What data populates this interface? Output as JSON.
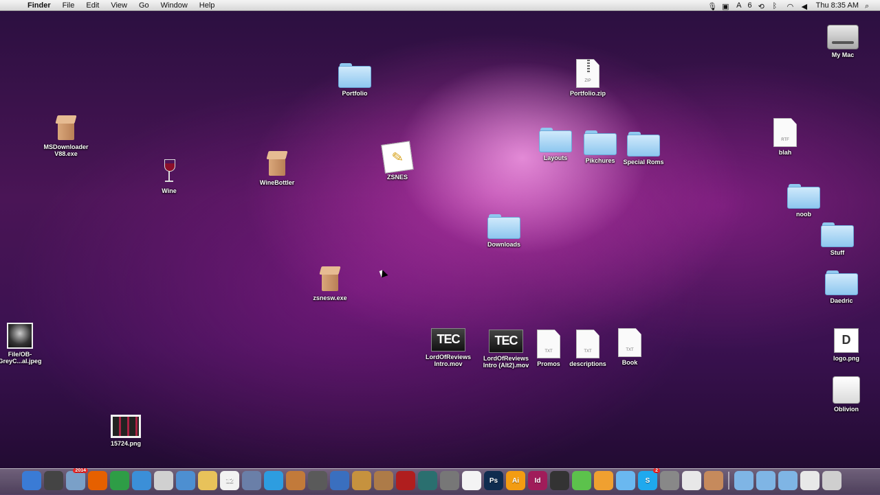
{
  "menubar": {
    "apple": "",
    "app": "Finder",
    "menus": [
      "File",
      "Edit",
      "View",
      "Go",
      "Window",
      "Help"
    ],
    "battery_count": "6",
    "clock": "Thu 8:35 AM",
    "status_icons": [
      "microphone-icon",
      "camera-icon",
      "adobe-icon",
      "time-machine-icon",
      "bluetooth-icon",
      "wifi-icon",
      "volume-icon",
      "search-icon"
    ]
  },
  "desktop": {
    "items": [
      {
        "label": "Portfolio",
        "type": "folder"
      },
      {
        "label": "Portfolio.zip",
        "type": "zip",
        "ext": "ZIP"
      },
      {
        "label": "My Mac",
        "type": "disk"
      },
      {
        "label": "MSDownloader\nV88.exe",
        "type": "box"
      },
      {
        "label": "Wine",
        "type": "wine"
      },
      {
        "label": "WineBottler",
        "type": "box"
      },
      {
        "label": "ZSNES",
        "type": "app"
      },
      {
        "label": "Layouts",
        "type": "folder"
      },
      {
        "label": "Pikchures",
        "type": "folder"
      },
      {
        "label": "Special Roms",
        "type": "folder"
      },
      {
        "label": "blah",
        "type": "doc",
        "ext": "RTF"
      },
      {
        "label": "noob",
        "type": "folder"
      },
      {
        "label": "Downloads",
        "type": "folder"
      },
      {
        "label": "Stuff",
        "type": "folder"
      },
      {
        "label": "Daedric",
        "type": "folder"
      },
      {
        "label": "zsnesw.exe",
        "type": "box"
      },
      {
        "label": "File/OB-\nGreyC...al.jpeg",
        "type": "image"
      },
      {
        "label": "LordOfReviews\nIntro.mov",
        "type": "movie",
        "text": "TEC"
      },
      {
        "label": "LordOfReviews\nIntro (Alt2).mov",
        "type": "movie",
        "text": "TEC"
      },
      {
        "label": "Promos",
        "type": "doc",
        "ext": "TXT"
      },
      {
        "label": "descriptions",
        "type": "doc",
        "ext": "TXT"
      },
      {
        "label": "Book",
        "type": "doc",
        "ext": "TXT"
      },
      {
        "label": "logo.png",
        "type": "logo",
        "text": "D"
      },
      {
        "label": "Oblivion",
        "type": "whitedisk"
      },
      {
        "label": "15724.png",
        "type": "image2"
      }
    ]
  },
  "dock": {
    "icons": [
      {
        "name": "finder-icon",
        "color": "#3a7bd5",
        "text": ""
      },
      {
        "name": "dashboard-icon",
        "color": "#444",
        "text": ""
      },
      {
        "name": "mail-icon",
        "color": "#7aa0c8",
        "text": "",
        "badge": "2014"
      },
      {
        "name": "firefox-icon",
        "color": "#e66000",
        "text": ""
      },
      {
        "name": "chrome-icon",
        "color": "#2e9d46",
        "text": ""
      },
      {
        "name": "safari-icon",
        "color": "#3b8fd8",
        "text": ""
      },
      {
        "name": "calculator-icon",
        "color": "#d0d0d0",
        "text": ""
      },
      {
        "name": "facetime-icon",
        "color": "#4d8fd1",
        "text": ""
      },
      {
        "name": "notes-icon",
        "color": "#e8c25a",
        "text": ""
      },
      {
        "name": "calendar-icon",
        "color": "#f2f2f2",
        "text": "12"
      },
      {
        "name": "photos-icon",
        "color": "#6a7fa8",
        "text": ""
      },
      {
        "name": "itunes-icon",
        "color": "#2d9de0",
        "text": ""
      },
      {
        "name": "iphoto-icon",
        "color": "#c27a3a",
        "text": ""
      },
      {
        "name": "imovie-icon",
        "color": "#5a5a5a",
        "text": ""
      },
      {
        "name": "quicktime-icon",
        "color": "#3a6fbf",
        "text": ""
      },
      {
        "name": "garageband-icon",
        "color": "#c6923e",
        "text": ""
      },
      {
        "name": "preview-icon",
        "color": "#ad7b48",
        "text": ""
      },
      {
        "name": "photobooth-icon",
        "color": "#b01e1e",
        "text": ""
      },
      {
        "name": "timemachine-icon",
        "color": "#2a6f6f",
        "text": ""
      },
      {
        "name": "preferences-icon",
        "color": "#777",
        "text": ""
      },
      {
        "name": "acrobat-icon",
        "color": "#f4f4f4",
        "text": ""
      },
      {
        "name": "photoshop-icon",
        "color": "#0f2c4f",
        "text": "Ps"
      },
      {
        "name": "illustrator-icon",
        "color": "#f39c12",
        "text": "Ai"
      },
      {
        "name": "indesign-icon",
        "color": "#a01c5a",
        "text": "Id"
      },
      {
        "name": "clapper-icon",
        "color": "#333",
        "text": ""
      },
      {
        "name": "frog-icon",
        "color": "#5cc24c",
        "text": ""
      },
      {
        "name": "p-icon",
        "color": "#f0a030",
        "text": ""
      },
      {
        "name": "w-icon",
        "color": "#6ab8f0",
        "text": ""
      },
      {
        "name": "skype-icon",
        "color": "#1fa9ee",
        "text": "S",
        "badge": "2"
      },
      {
        "name": "hanger-icon",
        "color": "#888",
        "text": ""
      },
      {
        "name": "paper-icon",
        "color": "#e8e8e8",
        "text": ""
      },
      {
        "name": "winebottler-icon",
        "color": "#c68a5c",
        "text": ""
      },
      {
        "name": "applications-folder-icon",
        "color": "#7fb5e5",
        "text": ""
      },
      {
        "name": "documents-folder-icon",
        "color": "#7fb5e5",
        "text": ""
      },
      {
        "name": "downloads-stack-icon",
        "color": "#7fb5e5",
        "text": ""
      },
      {
        "name": "stack-icon",
        "color": "#e8e8e8",
        "text": ""
      },
      {
        "name": "trash-icon",
        "color": "#cfcfcf",
        "text": ""
      }
    ]
  }
}
